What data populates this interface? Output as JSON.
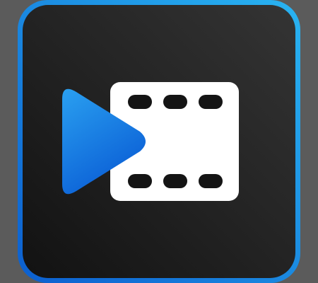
{
  "icon": {
    "name": "video-editor-app-icon",
    "symbols": [
      "play-icon",
      "film-strip-icon"
    ]
  },
  "colors": {
    "background": "#5b5b5b",
    "tile_dark": "#121212",
    "tile_light": "#343434",
    "border_bright": "#29b4f2",
    "border_deep": "#0c5fcf",
    "play_top": "#2aa0f0",
    "play_bottom": "#0b5fd6",
    "film_strip": "#ffffff",
    "sprocket": "#141414"
  }
}
